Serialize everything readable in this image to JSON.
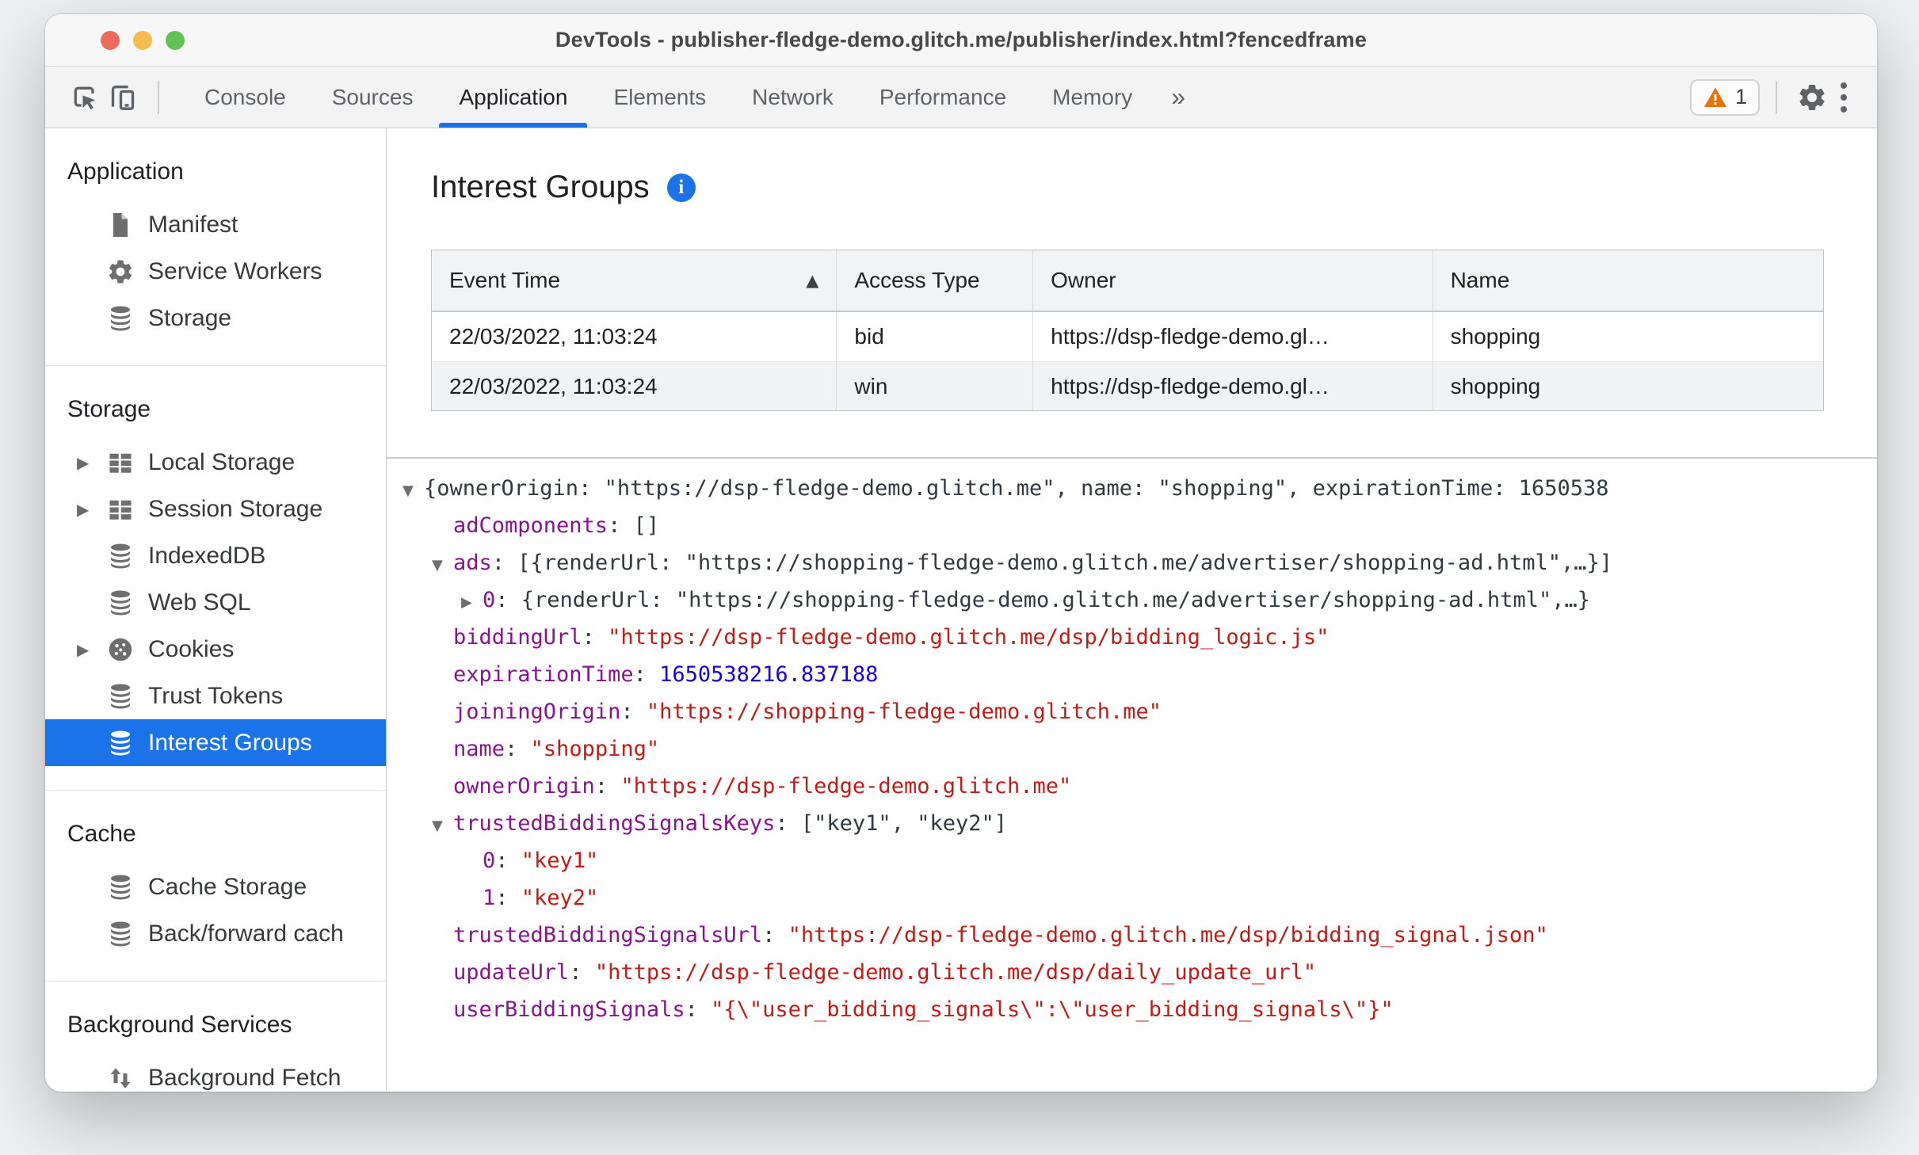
{
  "colors": {
    "accent_blue": "#1a73e8",
    "selected_item_bg": "#1a73e8",
    "json_key": "#881391",
    "json_string": "#c41a16",
    "json_number": "#1c00cf",
    "warning_orange": "#e8710a",
    "traffic_close": "#ee6a5f",
    "traffic_minimize": "#f5bd4f",
    "traffic_zoom": "#61c354"
  },
  "window": {
    "title": "DevTools - publisher-fledge-demo.glitch.me/publisher/index.html?fencedframe",
    "controls": [
      "close",
      "minimize",
      "zoom"
    ]
  },
  "toolbar": {
    "left_icons": [
      "inspect-cursor",
      "device-toolbar"
    ],
    "tabs": [
      {
        "label": "Console",
        "selected": false
      },
      {
        "label": "Sources",
        "selected": false
      },
      {
        "label": "Application",
        "selected": true
      },
      {
        "label": "Elements",
        "selected": false
      },
      {
        "label": "Network",
        "selected": false
      },
      {
        "label": "Performance",
        "selected": false
      },
      {
        "label": "Memory",
        "selected": false
      }
    ],
    "more_tabs_glyph": "»",
    "warning_count": "1",
    "right_icons": [
      "warning-badge",
      "settings-gear",
      "more-menu"
    ]
  },
  "sidebar": {
    "sections": [
      {
        "header": "Application",
        "items": [
          {
            "label": "Manifest",
            "icon": "file",
            "expander": false,
            "selected": false
          },
          {
            "label": "Service Workers",
            "icon": "gear",
            "expander": false,
            "selected": false
          },
          {
            "label": "Storage",
            "icon": "database",
            "expander": false,
            "selected": false
          }
        ]
      },
      {
        "header": "Storage",
        "items": [
          {
            "label": "Local Storage",
            "icon": "table",
            "expander": true,
            "selected": false
          },
          {
            "label": "Session Storage",
            "icon": "table",
            "expander": true,
            "selected": false
          },
          {
            "label": "IndexedDB",
            "icon": "database",
            "expander": false,
            "selected": false
          },
          {
            "label": "Web SQL",
            "icon": "database",
            "expander": false,
            "selected": false
          },
          {
            "label": "Cookies",
            "icon": "cookie",
            "expander": true,
            "selected": false
          },
          {
            "label": "Trust Tokens",
            "icon": "database",
            "expander": false,
            "selected": false
          },
          {
            "label": "Interest Groups",
            "icon": "database",
            "expander": false,
            "selected": true
          }
        ]
      },
      {
        "header": "Cache",
        "items": [
          {
            "label": "Cache Storage",
            "icon": "database",
            "expander": false,
            "selected": false
          },
          {
            "label": "Back/forward cach",
            "icon": "database",
            "expander": false,
            "selected": false
          }
        ]
      },
      {
        "header": "Background Services",
        "items": [
          {
            "label": "Background Fetch",
            "icon": "fetch-arrows",
            "expander": false,
            "selected": false
          }
        ]
      }
    ]
  },
  "main": {
    "heading": "Interest Groups",
    "info_icon_glyph": "i",
    "table": {
      "columns": [
        {
          "label": "Event Time",
          "sort": "asc"
        },
        {
          "label": "Access Type",
          "sort": null
        },
        {
          "label": "Owner",
          "sort": null
        },
        {
          "label": "Name",
          "sort": null
        }
      ],
      "rows": [
        [
          "22/03/2022, 11:03:24",
          "bid",
          "https://dsp-fledge-demo.gl…",
          "shopping"
        ],
        [
          "22/03/2022, 11:03:24",
          "win",
          "https://dsp-fledge-demo.gl…",
          "shopping"
        ]
      ]
    },
    "tree": {
      "lines": [
        {
          "indent": 0,
          "arrow": "down",
          "parts": [
            {
              "c": "p",
              "t": "{ownerOrigin: \"https://dsp-fledge-demo.glitch.me\", name: \"shopping\", expirationTime: 1650538"
            }
          ]
        },
        {
          "indent": 1,
          "arrow": null,
          "parts": [
            {
              "c": "k",
              "t": "adComponents"
            },
            {
              "c": "p",
              "t": ": []"
            }
          ]
        },
        {
          "indent": 1,
          "arrow": "down",
          "parts": [
            {
              "c": "k",
              "t": "ads"
            },
            {
              "c": "p",
              "t": ": [{renderUrl: \"https://shopping-fledge-demo.glitch.me/advertiser/shopping-ad.html\",…}]"
            }
          ]
        },
        {
          "indent": 2,
          "arrow": "right",
          "parts": [
            {
              "c": "k",
              "t": "0"
            },
            {
              "c": "p",
              "t": ": {renderUrl: \"https://shopping-fledge-demo.glitch.me/advertiser/shopping-ad.html\",…}"
            }
          ]
        },
        {
          "indent": 1,
          "arrow": null,
          "parts": [
            {
              "c": "k",
              "t": "biddingUrl"
            },
            {
              "c": "p",
              "t": ": "
            },
            {
              "c": "s",
              "t": "\"https://dsp-fledge-demo.glitch.me/dsp/bidding_logic.js\""
            }
          ]
        },
        {
          "indent": 1,
          "arrow": null,
          "parts": [
            {
              "c": "k",
              "t": "expirationTime"
            },
            {
              "c": "p",
              "t": ": "
            },
            {
              "c": "n",
              "t": "1650538216.837188"
            }
          ]
        },
        {
          "indent": 1,
          "arrow": null,
          "parts": [
            {
              "c": "k",
              "t": "joiningOrigin"
            },
            {
              "c": "p",
              "t": ": "
            },
            {
              "c": "s",
              "t": "\"https://shopping-fledge-demo.glitch.me\""
            }
          ]
        },
        {
          "indent": 1,
          "arrow": null,
          "parts": [
            {
              "c": "k",
              "t": "name"
            },
            {
              "c": "p",
              "t": ": "
            },
            {
              "c": "s",
              "t": "\"shopping\""
            }
          ]
        },
        {
          "indent": 1,
          "arrow": null,
          "parts": [
            {
              "c": "k",
              "t": "ownerOrigin"
            },
            {
              "c": "p",
              "t": ": "
            },
            {
              "c": "s",
              "t": "\"https://dsp-fledge-demo.glitch.me\""
            }
          ]
        },
        {
          "indent": 1,
          "arrow": "down",
          "parts": [
            {
              "c": "k",
              "t": "trustedBiddingSignalsKeys"
            },
            {
              "c": "p",
              "t": ": [\"key1\", \"key2\"]"
            }
          ]
        },
        {
          "indent": 2,
          "arrow": null,
          "parts": [
            {
              "c": "k",
              "t": "0"
            },
            {
              "c": "p",
              "t": ": "
            },
            {
              "c": "s",
              "t": "\"key1\""
            }
          ]
        },
        {
          "indent": 2,
          "arrow": null,
          "parts": [
            {
              "c": "k",
              "t": "1"
            },
            {
              "c": "p",
              "t": ": "
            },
            {
              "c": "s",
              "t": "\"key2\""
            }
          ]
        },
        {
          "indent": 1,
          "arrow": null,
          "parts": [
            {
              "c": "k",
              "t": "trustedBiddingSignalsUrl"
            },
            {
              "c": "p",
              "t": ": "
            },
            {
              "c": "s",
              "t": "\"https://dsp-fledge-demo.glitch.me/dsp/bidding_signal.json\""
            }
          ]
        },
        {
          "indent": 1,
          "arrow": null,
          "parts": [
            {
              "c": "k",
              "t": "updateUrl"
            },
            {
              "c": "p",
              "t": ": "
            },
            {
              "c": "s",
              "t": "\"https://dsp-fledge-demo.glitch.me/dsp/daily_update_url\""
            }
          ]
        },
        {
          "indent": 1,
          "arrow": null,
          "parts": [
            {
              "c": "k",
              "t": "userBiddingSignals"
            },
            {
              "c": "p",
              "t": ": "
            },
            {
              "c": "s",
              "t": "\"{\\\"user_bidding_signals\\\":\\\"user_bidding_signals\\\"}\""
            }
          ]
        }
      ]
    }
  }
}
